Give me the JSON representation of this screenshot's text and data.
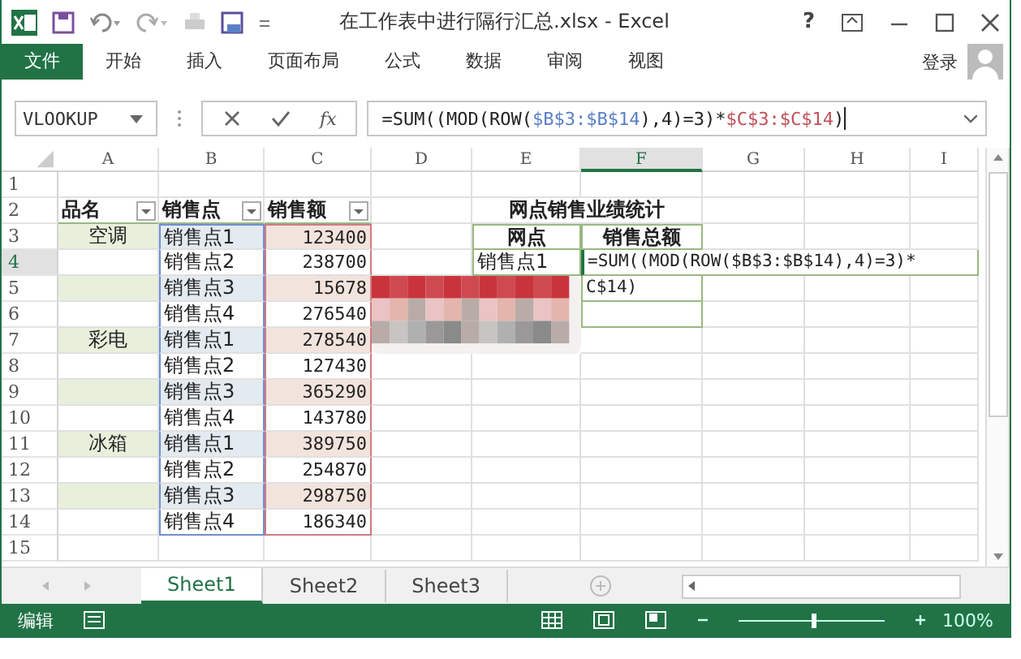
{
  "window": {
    "title": "在工作表中进行隔行汇总.xlsx - Excel",
    "help": "?"
  },
  "ribbon_tabs": [
    {
      "label": "文件",
      "selected": true
    },
    {
      "label": "开始",
      "selected": false
    },
    {
      "label": "插入",
      "selected": false
    },
    {
      "label": "页面布局",
      "selected": false
    },
    {
      "label": "公式",
      "selected": false
    },
    {
      "label": "数据",
      "selected": false
    },
    {
      "label": "审阅",
      "selected": false
    },
    {
      "label": "视图",
      "selected": false
    }
  ],
  "account": {
    "label": "登录"
  },
  "formula_bar": {
    "name_box": "VLOOKUP",
    "fx": "fx",
    "segments": [
      {
        "text": "=SUM((MOD(ROW(",
        "color": "#222222"
      },
      {
        "text": "$B$3:$B$14",
        "color": "#5b7fc7"
      },
      {
        "text": "),4)=3)*",
        "color": "#222222"
      },
      {
        "text": "$C$3:$C$14",
        "color": "#c0505a"
      },
      {
        "text": ")",
        "color": "#222222"
      }
    ]
  },
  "columns": [
    {
      "label": "A",
      "selected": false
    },
    {
      "label": "B",
      "selected": false
    },
    {
      "label": "C",
      "selected": false
    },
    {
      "label": "D",
      "selected": false
    },
    {
      "label": "E",
      "selected": false
    },
    {
      "label": "F",
      "selected": true
    },
    {
      "label": "G",
      "selected": false
    },
    {
      "label": "H",
      "selected": false
    },
    {
      "label": "I",
      "selected": false
    }
  ],
  "rows": [
    {
      "number": "1",
      "selected": false,
      "banded": false
    },
    {
      "number": "2",
      "selected": false,
      "banded": false,
      "kind": "header",
      "a": "品名",
      "b": "销售点",
      "c": "销售额",
      "summary_title": "网点销售业绩统计"
    },
    {
      "number": "3",
      "selected": false,
      "banded": true,
      "kind": "summary_header",
      "a": "空调",
      "b": "销售点1",
      "c": "123400",
      "e": "网点",
      "f": "销售总额"
    },
    {
      "number": "4",
      "selected": true,
      "banded": false,
      "kind": "summary_body",
      "b": "销售点2",
      "c": "238700",
      "e": "销售点1"
    },
    {
      "number": "5",
      "selected": false,
      "banded": true,
      "kind": "summary_body",
      "b": "销售点3",
      "c": "15678"
    },
    {
      "number": "6",
      "selected": false,
      "banded": false,
      "kind": "summary_body",
      "b": "销售点4",
      "c": "276540"
    },
    {
      "number": "7",
      "selected": false,
      "banded": true,
      "a": "彩电",
      "b": "销售点1",
      "c": "278540"
    },
    {
      "number": "8",
      "selected": false,
      "banded": false,
      "b": "销售点2",
      "c": "127430"
    },
    {
      "number": "9",
      "selected": false,
      "banded": true,
      "b": "销售点3",
      "c": "365290"
    },
    {
      "number": "10",
      "selected": false,
      "banded": false,
      "b": "销售点4",
      "c": "143780"
    },
    {
      "number": "11",
      "selected": false,
      "banded": true,
      "a": "冰箱",
      "b": "销售点1",
      "c": "389750"
    },
    {
      "number": "12",
      "selected": false,
      "banded": false,
      "b": "销售点2",
      "c": "254870"
    },
    {
      "number": "13",
      "selected": false,
      "banded": true,
      "b": "销售点3",
      "c": "298750"
    },
    {
      "number": "14",
      "selected": false,
      "banded": false,
      "b": "销售点4",
      "c": "186340"
    },
    {
      "number": "15",
      "selected": false,
      "banded": false
    }
  ],
  "cell_editor": {
    "lines": [
      "=SUM((MOD(ROW($B$3:$B$14),4)=3)*",
      "C$14)"
    ]
  },
  "sheet_tabs": [
    {
      "label": "Sheet1",
      "selected": true
    },
    {
      "label": "Sheet2",
      "selected": false
    },
    {
      "label": "Sheet3",
      "selected": false
    }
  ],
  "status_bar": {
    "mode": "编辑",
    "zoom": "100%",
    "zoom_slider": {
      "level": 0.5
    }
  }
}
